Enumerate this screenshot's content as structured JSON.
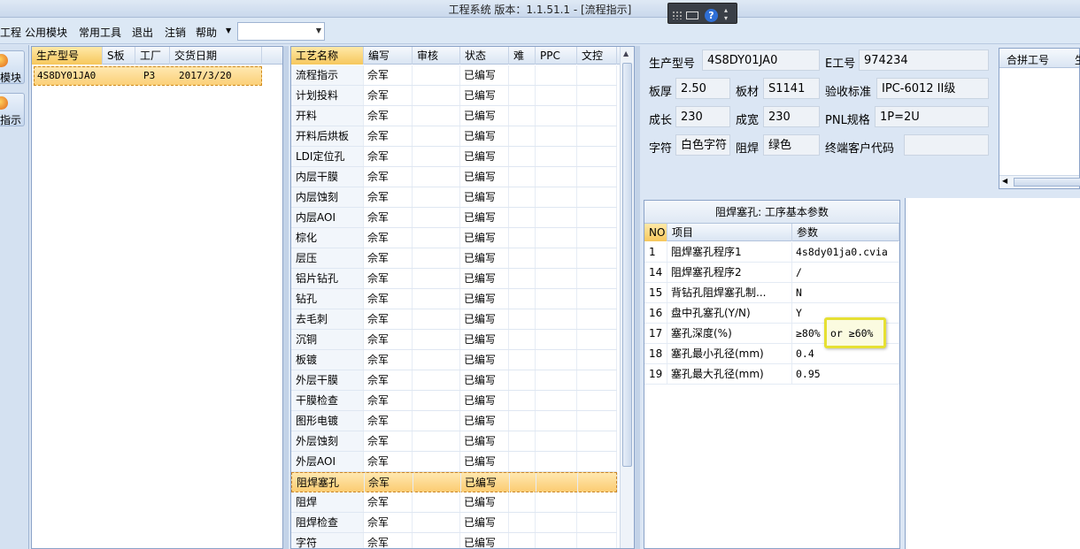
{
  "window": {
    "title": "工程系统   版本：1.1.51.1 - [流程指示]"
  },
  "menu": {
    "items": [
      "工程",
      "公用模块",
      "常用工具",
      "退出",
      "注销",
      "帮助"
    ],
    "combo_value": ""
  },
  "leftbar": {
    "buttons": [
      "模块",
      "指示"
    ]
  },
  "orders": {
    "headers": [
      "生产型号",
      "S板",
      "工厂",
      "交货日期"
    ],
    "rows": [
      {
        "model": "4S8DY01JA0",
        "s": "",
        "factory": "P3",
        "date": "2017/3/20"
      }
    ]
  },
  "process": {
    "headers": [
      "工艺名称",
      "编写",
      "审核",
      "状态",
      "难",
      "PPC",
      "文控"
    ],
    "rows": [
      {
        "name": "流程指示",
        "writer": "佘军",
        "status": "已编写"
      },
      {
        "name": "计划投料",
        "writer": "佘军",
        "status": "已编写"
      },
      {
        "name": "开料",
        "writer": "佘军",
        "status": "已编写"
      },
      {
        "name": "开料后烘板",
        "writer": "佘军",
        "status": "已编写"
      },
      {
        "name": "LDI定位孔",
        "writer": "佘军",
        "status": "已编写"
      },
      {
        "name": "内层干膜",
        "writer": "佘军",
        "status": "已编写"
      },
      {
        "name": "内层蚀刻",
        "writer": "佘军",
        "status": "已编写"
      },
      {
        "name": "内层AOI",
        "writer": "佘军",
        "status": "已编写"
      },
      {
        "name": "棕化",
        "writer": "佘军",
        "status": "已编写"
      },
      {
        "name": "层压",
        "writer": "佘军",
        "status": "已编写"
      },
      {
        "name": "铝片钻孔",
        "writer": "佘军",
        "status": "已编写"
      },
      {
        "name": "钻孔",
        "writer": "佘军",
        "status": "已编写"
      },
      {
        "name": "去毛刺",
        "writer": "佘军",
        "status": "已编写"
      },
      {
        "name": "沉铜",
        "writer": "佘军",
        "status": "已编写"
      },
      {
        "name": "板镀",
        "writer": "佘军",
        "status": "已编写"
      },
      {
        "name": "外层干膜",
        "writer": "佘军",
        "status": "已编写"
      },
      {
        "name": "干膜检查",
        "writer": "佘军",
        "status": "已编写"
      },
      {
        "name": "图形电镀",
        "writer": "佘军",
        "status": "已编写"
      },
      {
        "name": "外层蚀刻",
        "writer": "佘军",
        "status": "已编写"
      },
      {
        "name": "外层AOI",
        "writer": "佘军",
        "status": "已编写"
      },
      {
        "name": "阻焊塞孔",
        "writer": "佘军",
        "status": "已编写"
      },
      {
        "name": "阻焊",
        "writer": "佘军",
        "status": "已编写"
      },
      {
        "name": "阻焊检查",
        "writer": "佘军",
        "status": "已编写"
      },
      {
        "name": "字符",
        "writer": "佘军",
        "status": "已编写"
      }
    ],
    "selected_index": 20
  },
  "info": {
    "labels": {
      "model": "生产型号",
      "eno": "E工号",
      "thickness": "板厚",
      "material": "板材",
      "standard": "验收标准",
      "length": "成长",
      "width": "成宽",
      "pnl": "PNL规格",
      "char": "字符",
      "mask": "阻焊",
      "customer": "终端客户代码"
    },
    "values": {
      "model": "4S8DY01JA0",
      "eno": "974234",
      "thickness": "2.50",
      "material": "S1141",
      "standard": "IPC-6012 II级",
      "length": "230",
      "width": "230",
      "pnl": "1P=2U",
      "char": "白色字符",
      "mask": "绿色",
      "customer": ""
    }
  },
  "merge": {
    "header": "合拼工号",
    "header2": "生"
  },
  "params": {
    "title": "阻焊塞孔: 工序基本参数",
    "headers": [
      "NO",
      "项目",
      "参数"
    ],
    "rows": [
      {
        "no": "1",
        "item": "阻焊塞孔程序1",
        "value": "4s8dy01ja0.cvia"
      },
      {
        "no": "14",
        "item": "阻焊塞孔程序2",
        "value": "/"
      },
      {
        "no": "15",
        "item": "背钻孔阻焊塞孔制...",
        "value": "N"
      },
      {
        "no": "16",
        "item": "盘中孔塞孔(Y/N)",
        "value": "Y"
      },
      {
        "no": "17",
        "item": "塞孔深度(%)",
        "value": "≥80%"
      },
      {
        "no": "18",
        "item": "塞孔最小孔径(mm)",
        "value": "0.4"
      },
      {
        "no": "19",
        "item": "塞孔最大孔径(mm)",
        "value": "0.95"
      }
    ],
    "edit_value": "or ≥60%"
  },
  "colors": {
    "selected_row": "#fbd078",
    "header_active": "#f6c75c",
    "highlight": "#e6e033"
  }
}
